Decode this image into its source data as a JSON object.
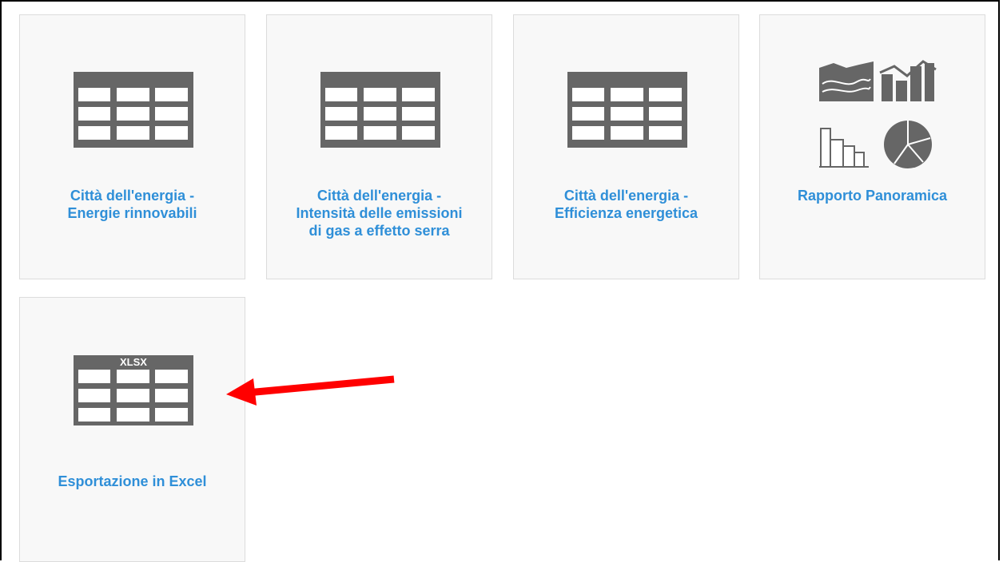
{
  "tiles": [
    {
      "label": "Città dell'energia -\nEnergie rinnovabili",
      "icon": "table-icon"
    },
    {
      "label": "Città dell'energia -\nIntensità delle emissioni\ndi gas a effetto serra",
      "icon": "table-icon"
    },
    {
      "label": "Città dell'energia -\nEfficienza energetica",
      "icon": "table-icon"
    },
    {
      "label": "Rapporto Panoramica",
      "icon": "charts-icon"
    },
    {
      "label": "Esportazione in Excel",
      "icon": "xlsx-table-icon",
      "badge": "XLSX"
    }
  ],
  "annotation": {
    "arrow": "red-arrow-icon",
    "color": "#ff0000"
  },
  "colors": {
    "link": "#2f8fd8",
    "icon": "#666666",
    "tile_bg": "#f8f8f8",
    "tile_border": "#dcdcdc"
  }
}
